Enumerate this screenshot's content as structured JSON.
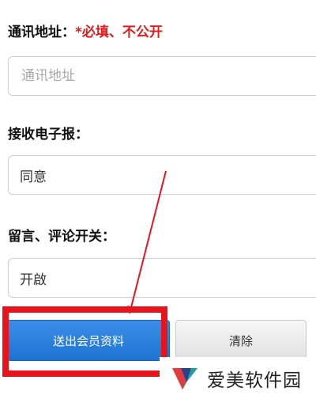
{
  "form": {
    "address": {
      "label": "通讯地址：",
      "required_note": "*必填、不公开",
      "placeholder": "通讯地址",
      "value": ""
    },
    "newsletter": {
      "label": "接收电子报：",
      "value": "同意"
    },
    "comments": {
      "label": "留言、评论开关：",
      "value": "开啟"
    }
  },
  "buttons": {
    "submit_label": "送出会员资料",
    "clear_label": "清除"
  },
  "annotation": {
    "color": "#e8141b"
  },
  "watermark": {
    "text": "爱美软件园"
  }
}
